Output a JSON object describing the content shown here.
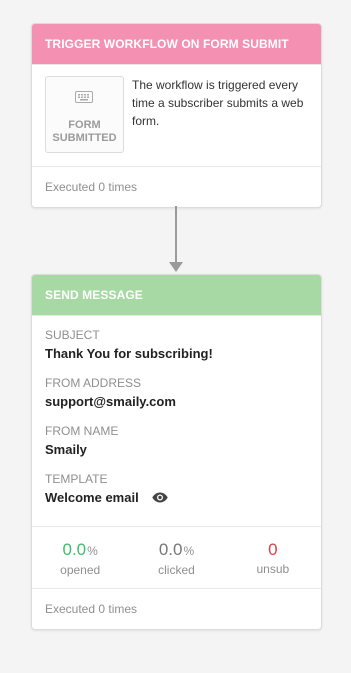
{
  "colors": {
    "trigger_header": "#f490b1",
    "message_header": "#a7d9a5",
    "opened": "#3cbf6a",
    "clicked": "#777777",
    "unsub": "#d64545"
  },
  "trigger": {
    "title": "TRIGGER WORKFLOW ON FORM SUBMIT",
    "badge_icon": "keyboard-icon",
    "badge_line1": "FORM",
    "badge_line2": "SUBMITTED",
    "description": "The workflow is triggered every time a subscriber submits a web form.",
    "executed": "Executed 0 times"
  },
  "message": {
    "title": "SEND MESSAGE",
    "subject_label": "SUBJECT",
    "subject_value": "Thank You for subscribing!",
    "from_address_label": "FROM ADDRESS",
    "from_address_value": "support@smaily.com",
    "from_name_label": "FROM NAME",
    "from_name_value": "Smaily",
    "template_label": "TEMPLATE",
    "template_value": "Welcome email",
    "template_preview_icon": "eye-icon",
    "stats": {
      "opened_value": "0.0",
      "opened_unit": "%",
      "opened_label": "opened",
      "clicked_value": "0.0",
      "clicked_unit": "%",
      "clicked_label": "clicked",
      "unsub_value": "0",
      "unsub_label": "unsub"
    },
    "executed": "Executed 0 times"
  }
}
